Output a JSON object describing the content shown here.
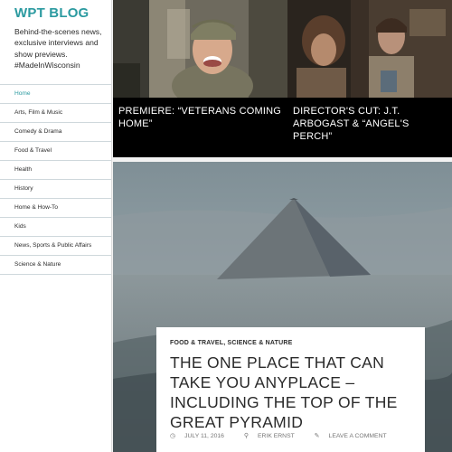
{
  "site": {
    "title": "WPT BLOG",
    "description": "Behind-the-scenes news, exclusive interviews and show previews. #MadeInWisconsin"
  },
  "nav": {
    "items": [
      {
        "label": "Home",
        "active": true
      },
      {
        "label": "Arts, Film & Music"
      },
      {
        "label": "Comedy & Drama"
      },
      {
        "label": "Food & Travel"
      },
      {
        "label": "Health"
      },
      {
        "label": "History"
      },
      {
        "label": "Home & How-To"
      },
      {
        "label": "Kids"
      },
      {
        "label": "News, Sports & Public Affairs"
      },
      {
        "label": "Science & Nature"
      }
    ]
  },
  "featured": [
    {
      "caption": "PREMIERE: “VETERANS COMING HOME”"
    },
    {
      "caption": "DIRECTOR'S CUT: J.T. ARBOGAST & “ANGEL'S PERCH”"
    }
  ],
  "post": {
    "categories": "FOOD & TRAVEL, SCIENCE & NATURE",
    "title": "THE ONE PLACE THAT CAN TAKE YOU ANYPLACE – INCLUDING THE TOP OF THE GREAT PYRAMID",
    "date": "JULY 11, 2016",
    "author": "ERIK ERNST",
    "comment": "LEAVE A COMMENT"
  },
  "icons": {
    "date": "clock-icon",
    "author": "person-icon",
    "comment": "speech-bubble-icon"
  },
  "colors": {
    "accent": "#2b9aa0",
    "featured_bg": "#000000",
    "sidebar_bg": "#ffffff"
  }
}
